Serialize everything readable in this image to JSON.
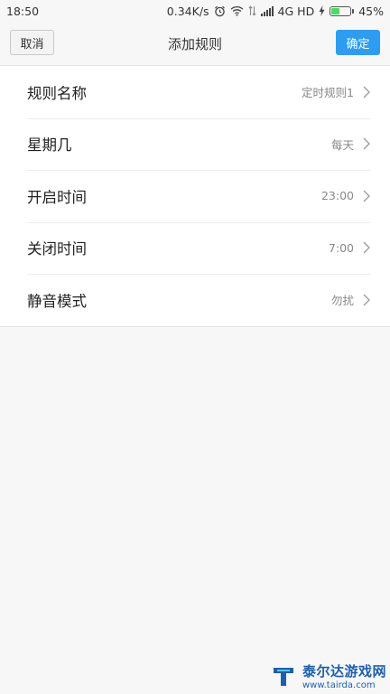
{
  "status_bar": {
    "time": "18:50",
    "net_speed": "0.34K/s",
    "network": "4G HD",
    "battery_percent": "45%",
    "battery_level": 0.45,
    "icons": [
      "alarm-icon",
      "wifi-icon",
      "data-arrows-icon",
      "signal-icon",
      "charging-icon"
    ]
  },
  "title_bar": {
    "cancel_label": "取消",
    "title": "添加规则",
    "ok_label": "确定",
    "ok_color": "#2e9cf1"
  },
  "rows": [
    {
      "label": "规则名称",
      "value": "定时规则1"
    },
    {
      "label": "星期几",
      "value": "每天"
    },
    {
      "label": "开启时间",
      "value": "23:00"
    },
    {
      "label": "关闭时间",
      "value": "7:00"
    },
    {
      "label": "静音模式",
      "value": "勿扰"
    }
  ],
  "watermark": {
    "title": "泰尔达游戏网",
    "url": "www.tairda.com"
  }
}
